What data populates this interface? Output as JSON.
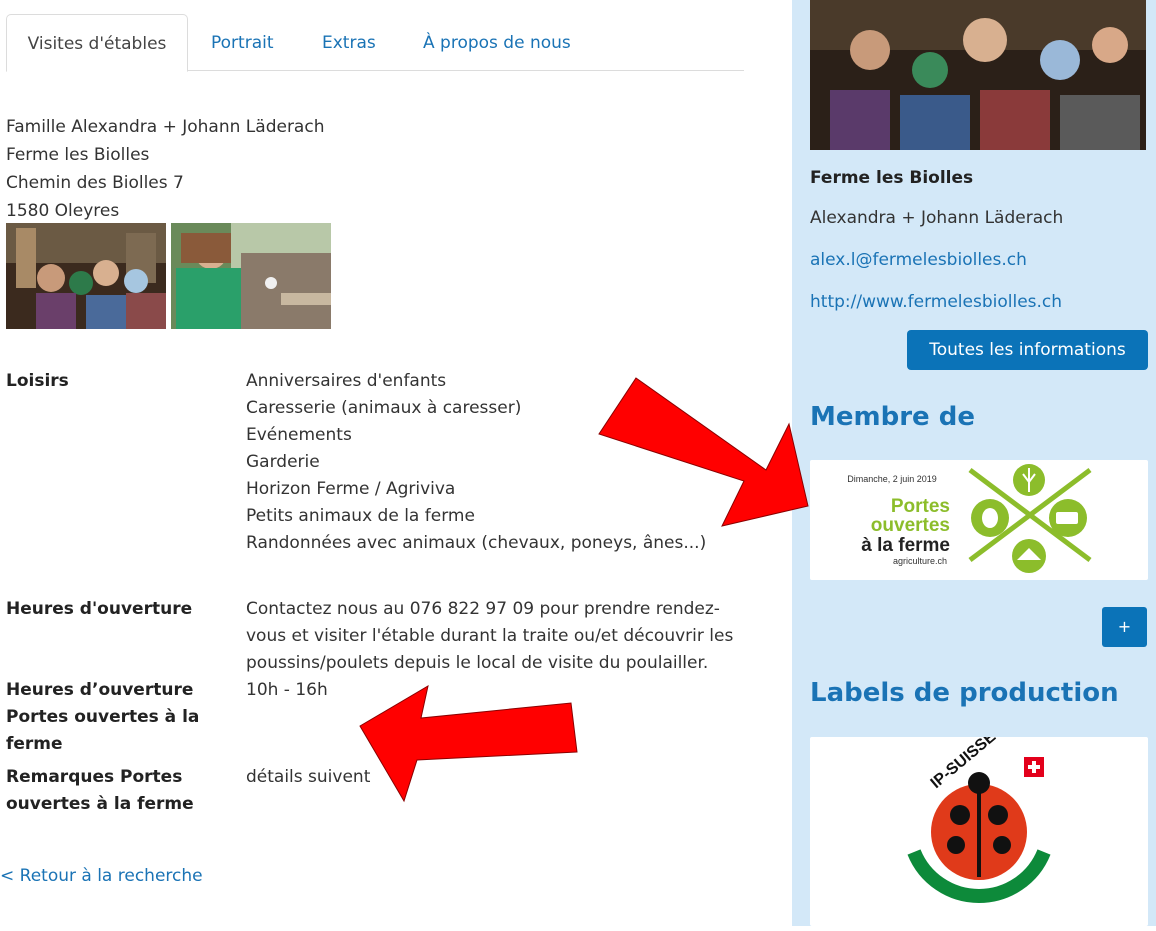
{
  "tabs": [
    {
      "label": "Visites d'étables",
      "active": true
    },
    {
      "label": "Portrait"
    },
    {
      "label": "Extras"
    },
    {
      "label": "À propos de nous"
    }
  ],
  "address": [
    "Famille Alexandra + Johann Läderach",
    "Ferme les Biolles",
    "Chemin des Biolles 7",
    "1580 Oleyres"
  ],
  "details": {
    "loisirs_label": "Loisirs",
    "loisirs": [
      "Anniversaires d'enfants",
      "Caresserie (animaux à caresser)",
      "Evénements",
      "Garderie",
      "Horizon Ferme / Agriviva",
      "Petits animaux de la ferme",
      "Randonnées avec animaux (chevaux, poneys, ânes...)"
    ],
    "heures_label": "Heures d'ouverture",
    "heures": [
      "Contactez nous au 076 822 97 09 pour prendre rendez-",
      "vous et visiter l'étable durant la traite ou/et découvrir les",
      "poussins/poulets depuis le local de visite du poulailler."
    ],
    "heures_po_label": [
      "Heures d’ouverture",
      "Portes ouvertes à la",
      "ferme"
    ],
    "heures_po": "10h - 16h",
    "remarques_label": [
      "Remarques Portes",
      "ouvertes à la ferme"
    ],
    "remarques": "détails suivent"
  },
  "back_link": "< Retour à la recherche",
  "sidebar": {
    "farm_name": "Ferme les Biolles",
    "owner": "Alexandra + Johann Läderach",
    "email": "alex.l@fermelesbiolles.ch",
    "website": "http://www.fermelesbiolles.ch",
    "info_button": "Toutes les informations",
    "member_heading": "Membre de",
    "portes_logo": {
      "date": "Dimanche, 2 juin 2019",
      "line1": "Portes",
      "line2": "ouvertes",
      "line3": "à la ferme",
      "site": "agriculture.ch"
    },
    "plus_button": "+",
    "labels_heading": "Labels de production",
    "ip_logo": {
      "text": "IP-SUISSE"
    }
  },
  "colors": {
    "accent": "#0b73b8",
    "link": "#1a73b5",
    "sidebar_bg": "#d3e8f8",
    "logo_green": "#8cbd2b",
    "arrow_red": "#ff0000"
  }
}
